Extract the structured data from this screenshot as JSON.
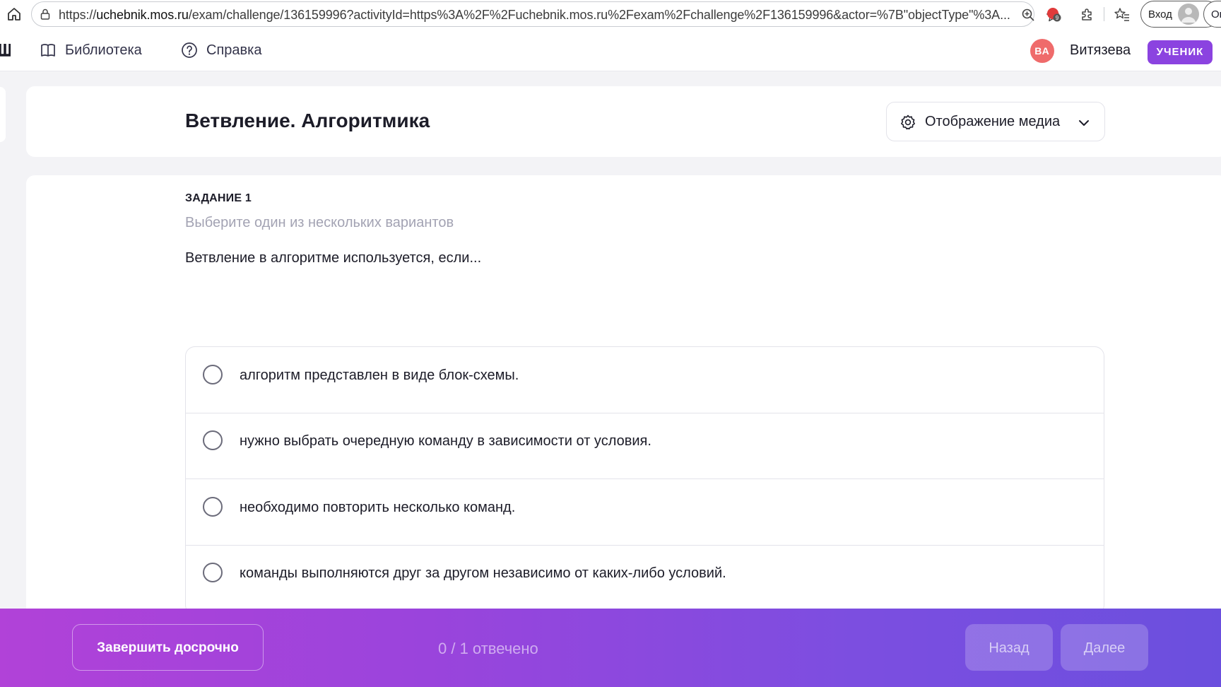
{
  "browser": {
    "url_prefix": "https://",
    "url_host": "uchebnik.mos.ru",
    "url_rest": "/exam/challenge/136159996?activityId=https%3A%2F%2Fuchebnik.mos.ru%2Fexam%2Fchallenge%2F136159996&actor=%7B\"objectType\"%3A...",
    "login_label": "Вход",
    "overflow_label": "Ог",
    "extension_badge_count": "9"
  },
  "header": {
    "nav": [
      {
        "label": "Библиотека",
        "icon": "book-icon"
      },
      {
        "label": "Справка",
        "icon": "help-circle-icon"
      }
    ],
    "user_initials": "ВА",
    "user_name": "Витязева",
    "role": "УЧЕНИК"
  },
  "title_card": {
    "title": "Ветвление. Алгоритмика",
    "media_dropdown_label": "Отображение медиа"
  },
  "task": {
    "number": "ЗАДАНИЕ 1",
    "instruction": "Выберите один из нескольких вариантов",
    "question": "Ветвление в алгоритме используется, если...",
    "options": [
      "алгоритм представлен в виде блок-схемы.",
      "нужно выбрать очередную команду в зависимости от условия.",
      "необходимо повторить несколько команд.",
      "команды выполняются друг за другом независимо от каких-либо условий."
    ]
  },
  "footer": {
    "finish_label": "Завершить досрочно",
    "progress": "0 / 1 отвечено",
    "back_label": "Назад",
    "next_label": "Далее"
  },
  "colors": {
    "accent": "#8b43e0",
    "avatar": "#ef6b6b",
    "gradient_start": "#b142d8",
    "gradient_end": "#6b4fde"
  }
}
